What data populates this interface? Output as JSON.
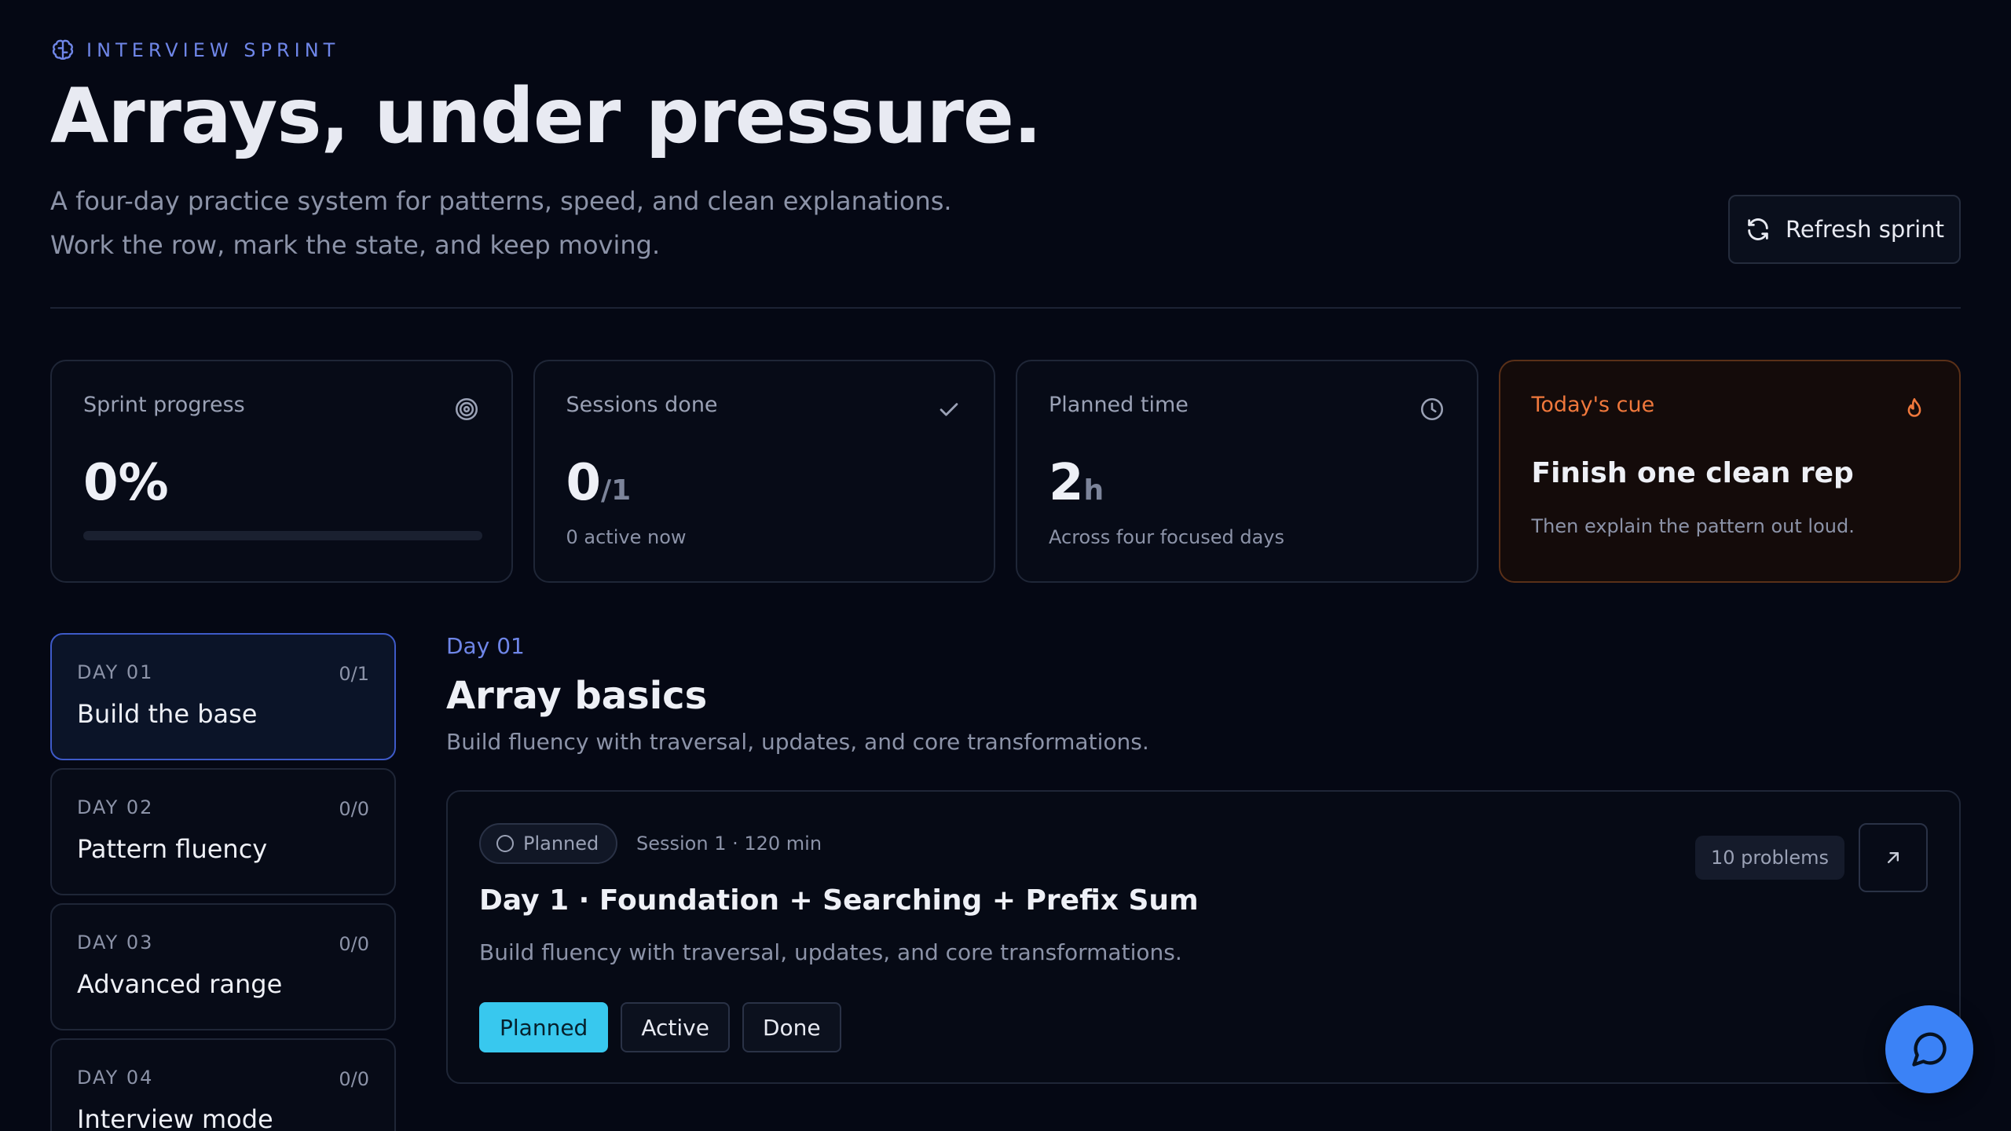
{
  "header": {
    "eyebrow": "INTERVIEW SPRINT",
    "title": "Arrays, under pressure.",
    "subtitle_line1": "A four-day practice system for patterns, speed, and clean explanations.",
    "subtitle_line2": "Work the row, mark the state, and keep moving.",
    "refresh_label": "Refresh sprint"
  },
  "stats": {
    "progress": {
      "label": "Sprint progress",
      "value": "0%",
      "fraction": 0
    },
    "sessions": {
      "label": "Sessions done",
      "value": "0",
      "total": "/1",
      "sub": "0 active now"
    },
    "time": {
      "label": "Planned time",
      "value": "2",
      "unit": "h",
      "sub": "Across four focused days"
    },
    "cue": {
      "label": "Today's cue",
      "headline": "Finish one clean rep",
      "sub": "Then explain the pattern out loud."
    }
  },
  "days": [
    {
      "label": "DAY 01",
      "count": "0/1",
      "title": "Build the base",
      "active": true
    },
    {
      "label": "DAY 02",
      "count": "0/0",
      "title": "Pattern fluency",
      "active": false
    },
    {
      "label": "DAY 03",
      "count": "0/0",
      "title": "Advanced range",
      "active": false
    },
    {
      "label": "DAY 04",
      "count": "0/0",
      "title": "Interview mode",
      "active": false
    }
  ],
  "main": {
    "kicker": "Day 01",
    "title": "Array basics",
    "description": "Build fluency with traversal, updates, and core transformations.",
    "session": {
      "status": "Planned",
      "meta": "Session 1 · 120 min",
      "problems": "10 problems",
      "title": "Day 1 · Foundation + Searching + Prefix Sum",
      "description": "Build fluency with traversal, updates, and core transformations.",
      "states": [
        "Planned",
        "Active",
        "Done"
      ],
      "selected_state": "Planned"
    }
  },
  "colors": {
    "background": "#050814",
    "accent_blue": "#6f86e8",
    "cyan": "#38c8ee",
    "cue_orange": "#f0783c",
    "fab_blue": "#3b82f6"
  },
  "icons": {
    "eyebrow": "brain-icon",
    "refresh": "refresh-icon",
    "progress": "target-icon",
    "sessions": "check-icon",
    "time": "clock-icon",
    "cue": "flame-icon",
    "open": "arrow-up-right-icon",
    "fab": "chat-bubble-icon"
  }
}
